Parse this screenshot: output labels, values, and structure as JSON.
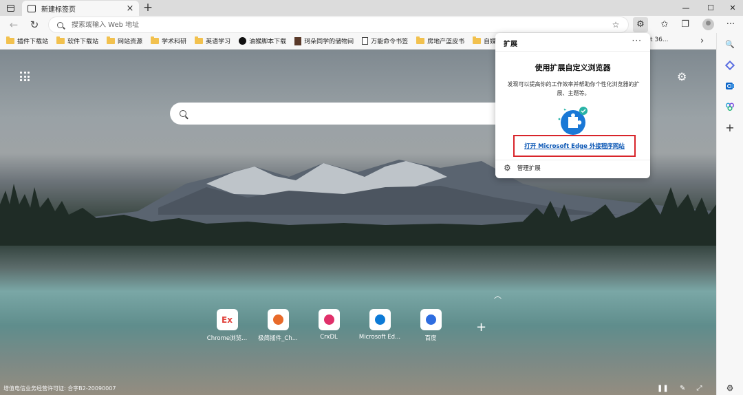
{
  "tab": {
    "title": "新建标签页",
    "close": "×",
    "new_tab": "+"
  },
  "window": {
    "minimize": "—",
    "maximize": "☐",
    "close": "✕"
  },
  "toolbar": {
    "back": "←",
    "refresh": "↻",
    "address_placeholder": "搜索或输入 Web 地址",
    "favorite_icon": "☆",
    "extensions_icon": "⚙",
    "favorites_icon": "✩",
    "collections_icon": "❐",
    "more": "···"
  },
  "bookmarks": [
    {
      "label": "插件下载站",
      "icon": "folder"
    },
    {
      "label": "软件下载站",
      "icon": "folder"
    },
    {
      "label": "网站资源",
      "icon": "folder"
    },
    {
      "label": "学术科研",
      "icon": "folder"
    },
    {
      "label": "英语学习",
      "icon": "folder"
    },
    {
      "label": "油猴脚本下载",
      "icon": "globe"
    },
    {
      "label": "珂朵同学的储物间",
      "icon": "person"
    },
    {
      "label": "万能命令书签",
      "icon": "document"
    },
    {
      "label": "房地产蓝皮书",
      "icon": "folder"
    },
    {
      "label": "自媒体运",
      "icon": "folder"
    }
  ],
  "bookmarks_more": "›",
  "ext_peek": "t 36...",
  "sidebar": {
    "search": "🔍",
    "add": "+",
    "settings": "⚙",
    "colors": {
      "diamond": "#5b6ee1",
      "outlook": "#0a64c8",
      "mixed": "#2aa1d8"
    }
  },
  "newtab": {
    "settings_icon": "⚙",
    "search_placeholder": "",
    "collapse": "︿",
    "tiles": [
      {
        "label": "Chrome浏览...",
        "icon_text": "Ex",
        "color": "#e0403a"
      },
      {
        "label": "极简插件_Ch...",
        "icon_text": "",
        "color": "#e86a2a"
      },
      {
        "label": "CrxDL",
        "icon_text": "",
        "color": "#e0306a"
      },
      {
        "label": "Microsoft Ed...",
        "icon_text": "",
        "color": "#0c7ad6"
      },
      {
        "label": "百度",
        "icon_text": "",
        "color": "#2e6de0"
      }
    ],
    "add_tile": "+",
    "license": "增值电信业务经营许可证: 合字B2-20090007",
    "bottom_controls": [
      "❚❚",
      "✎",
      "⤢"
    ]
  },
  "extensions_popup": {
    "header": "扩展",
    "more": "···",
    "title": "使用扩展自定义浏览器",
    "description": "发现可以提高你的工作效率并帮助你个性化浏览器的扩展、主题等。",
    "link": "打开 Microsoft Edge 外接程序网站",
    "manage_icon": "⚙",
    "manage": "管理扩展",
    "accent": "#1a78d6",
    "highlight": "#d8242a"
  }
}
